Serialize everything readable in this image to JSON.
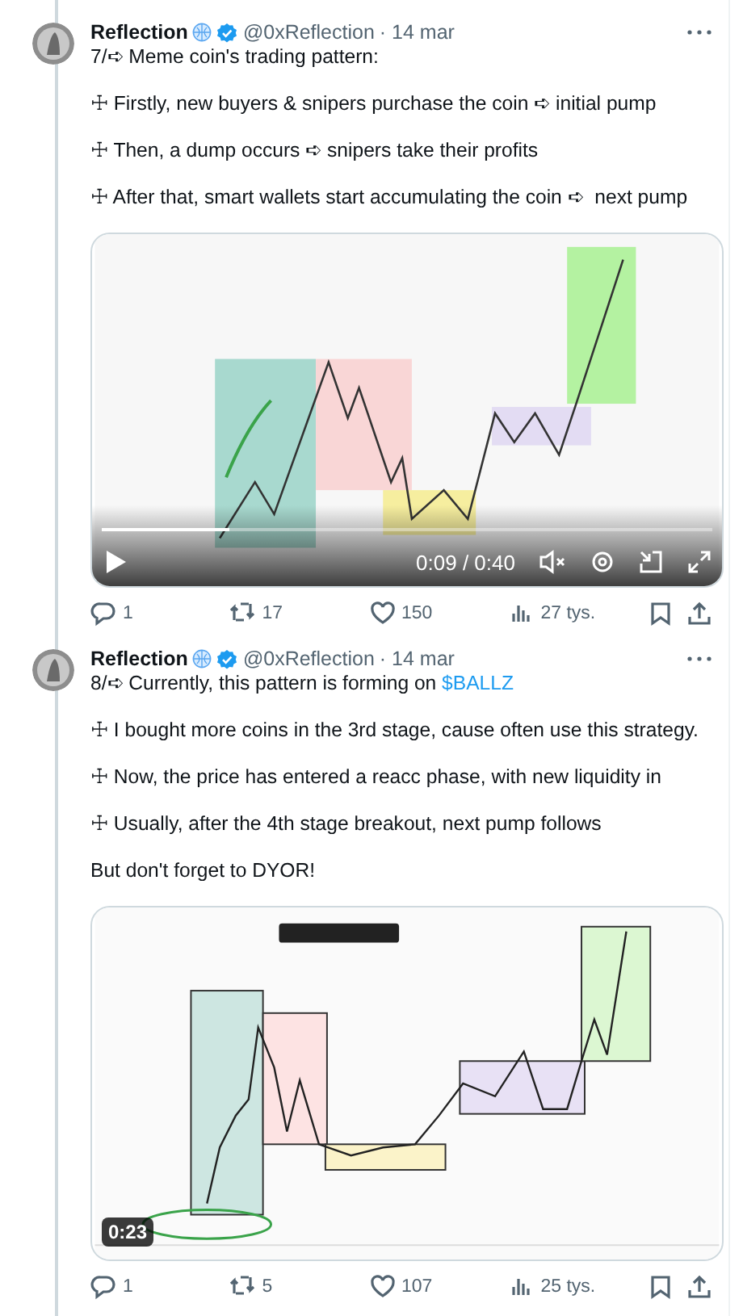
{
  "tweets": [
    {
      "author": "Reflection",
      "handle": "@0xReflection",
      "date": "· 14 mar",
      "paragraphs": [
        {
          "text": "7/➪ Meme coin's trading pattern:"
        },
        {
          "text": "☩ Firstly, new buyers & snipers purchase the coin ➪ initial pump"
        },
        {
          "text": "☩ Then, a dump occurs ➪ snipers take their profits"
        },
        {
          "text": "☩ After that, smart wallets start accumulating the coin ➪  next pump"
        }
      ],
      "media": {
        "kind": "player",
        "time": "0:09 / 0:40",
        "level": 0.21
      },
      "actions": {
        "replies": "1",
        "reposts": "17",
        "likes": "150",
        "views": "27 tys."
      }
    },
    {
      "author": "Reflection",
      "handle": "@0xReflection",
      "date": "· 14 mar",
      "paragraphs": [
        {
          "text": "8/➪ Currently, this pattern is forming on ",
          "link": "$BALLZ"
        },
        {
          "text": "☩ I bought more coins in the 3rd stage, cause often use this strategy."
        },
        {
          "text": "☩ Now, the price has entered a reacc phase, with new liquidity in"
        },
        {
          "text": "☩ Usually, after the 4th stage breakout, next pump follows"
        },
        {
          "text": "But don't forget to DYOR!"
        }
      ],
      "media": {
        "kind": "gif",
        "time": "0:23"
      },
      "actions": {
        "replies": "1",
        "reposts": "5",
        "likes": "107",
        "views": "25 tys."
      }
    }
  ]
}
